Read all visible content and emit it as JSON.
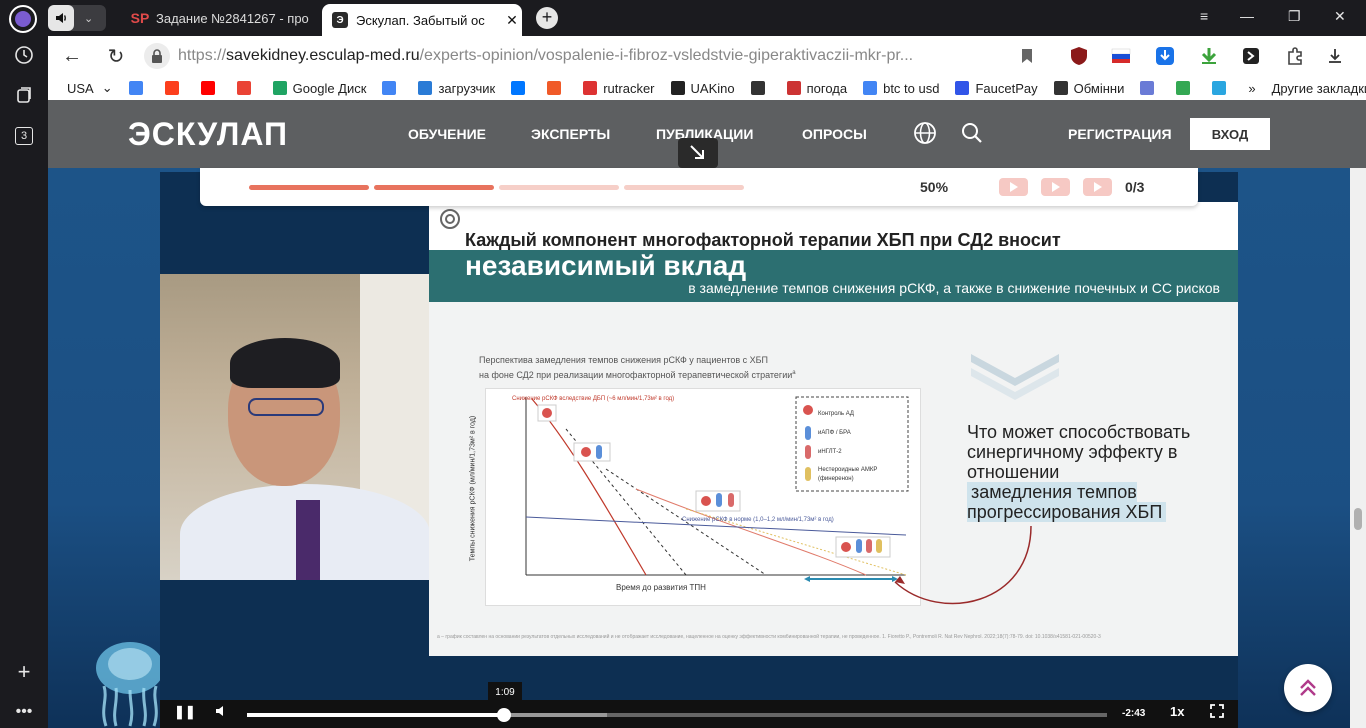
{
  "browser": {
    "tabs": [
      {
        "label": "Задание №2841267 - про",
        "favicon": "SP"
      },
      {
        "label": "Эскулап. Забытый ос",
        "favicon": "Э"
      }
    ],
    "url": {
      "protocol": "https://",
      "host": "savekidney.esculap-med.ru",
      "path": "/experts-opinion/vospalenie-i-fibroz-vsledstvie-giperaktivaczii-mkr-pr..."
    },
    "sidebar_badge": "3",
    "bookmarks": [
      {
        "label": "USA",
        "icon": "dropdown",
        "color": "#ffffff"
      },
      {
        "label": "",
        "icon": "google",
        "color": "#4285f4"
      },
      {
        "label": "",
        "icon": "yandex",
        "color": "#fc3f1d"
      },
      {
        "label": "",
        "icon": "youtube",
        "color": "#ff0000"
      },
      {
        "label": "",
        "icon": "gmail",
        "color": "#ea4335"
      },
      {
        "label": "Google Диск",
        "icon": "gdrive",
        "color": "#1fa463"
      },
      {
        "label": "",
        "icon": "translate",
        "color": "#4285f4"
      },
      {
        "label": "загрузчик",
        "icon": "loader",
        "color": "#2a7bd6"
      },
      {
        "label": "",
        "icon": "vk",
        "color": "#0077ff"
      },
      {
        "label": "",
        "icon": "f-app",
        "color": "#f05a28"
      },
      {
        "label": "rutracker",
        "icon": "rutracker",
        "color": "#d33"
      },
      {
        "label": "UAKino",
        "icon": "uakino",
        "color": "#222"
      },
      {
        "label": "",
        "icon": "chess",
        "color": "#333"
      },
      {
        "label": "погода",
        "icon": "thermometer",
        "color": "#c33"
      },
      {
        "label": "btc to usd",
        "icon": "google",
        "color": "#4285f4"
      },
      {
        "label": "FaucetPay",
        "icon": "faucetpay",
        "color": "#3155e8"
      },
      {
        "label": "Обмінни",
        "icon": "bc",
        "color": "#333"
      },
      {
        "label": "",
        "icon": "exchange",
        "color": "#6a7bd6"
      },
      {
        "label": "",
        "icon": "maps",
        "color": "#34a853"
      },
      {
        "label": "",
        "icon": "star",
        "color": "#2aa6e0"
      },
      {
        "label": "»",
        "icon": "more",
        "color": "#555"
      }
    ],
    "other_bookmarks": "Другие закладки"
  },
  "site": {
    "logo": "ЭСКУЛАП",
    "nav": [
      "ОБУЧЕНИЕ",
      "ЭКСПЕРТЫ",
      "ПУБЛИКАЦИИ",
      "ОПРОСЫ"
    ],
    "register": "РЕГИСТРАЦИЯ",
    "login": "ВХОД"
  },
  "progress": {
    "percent_label": "50%",
    "percent": 50,
    "videos_label": "0/3",
    "segment_colors": [
      "#e8735e",
      "#e8735e",
      "#f6cfc8",
      "#f6cfc8"
    ],
    "accent": "#e8735e"
  },
  "slide": {
    "title_line1": "Каждый компонент многофакторной терапии ХБП при СД2 вносит",
    "title_line2": "независимый вклад",
    "subtitle": "в замедление темпов снижения рСКФ, а также в снижение почечных и СС рисков",
    "chart_caption_l1": "Перспектива замедления темпов снижения рСКФ у пациентов с ХБП",
    "chart_caption_l2": "на фоне СД2 при реализации многофакторной терапевтической стратегии",
    "chart_caption_sup": "а",
    "ylabel": "Темпы снижения рСКФ (мл/мин/1,73м² в год)",
    "xlabel": "Время до развития ТПН",
    "line_label_top": "Снижение рСКФ вследствие ДБП (~6 мл/мин/1,73м² в год)",
    "line_label_norm": "Снижение рСКФ в норме (1,0–1,2 мл/мин/1,73м² в год)",
    "legend": [
      "Контроль АД",
      "иАПФ / БРА",
      "иНГЛТ-2",
      "Нестероидные АМКР (финеренон)"
    ],
    "question_plain": "Что может способствовать синергичному эффекту в отношении",
    "question_highlight": "замедления темпов прогрессирования ХБП",
    "footnote": "а – график составлен на основании результатов отдельных исследований и не отображает исследование, нацеленное на оценку эффективности комбинированной терапии, не проведенное. 1. Fioretto P., Pontremoli R. Nat Rev Nephrol. 2022;18(7):78-79. doi: 10.1038/s41581-021-00520-3"
  },
  "player": {
    "time_tooltip": "1:09",
    "remaining": "-2:43",
    "speed": "1x",
    "played_fraction": 0.299,
    "buffered_fraction": 0.419
  }
}
